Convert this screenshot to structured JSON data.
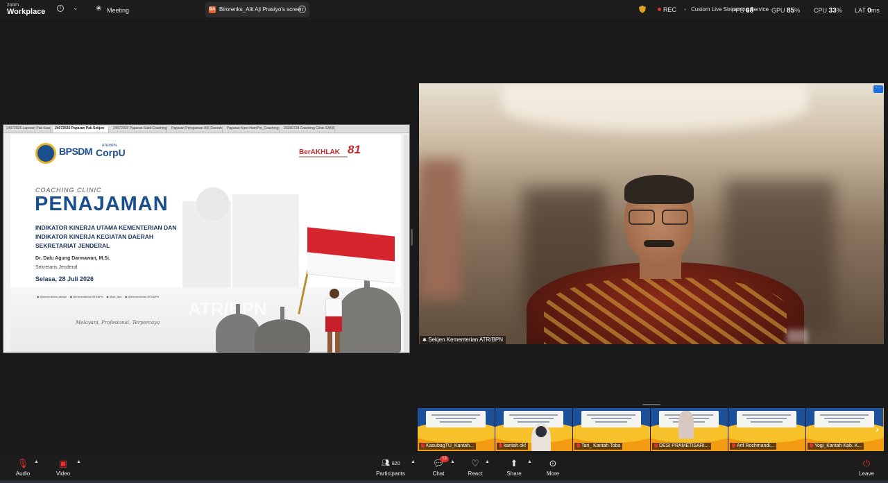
{
  "app": {
    "brand_small": "zoom",
    "brand_big": "Workplace"
  },
  "topbar": {
    "meeting_label": "Meeting",
    "share_tab_label": "Birorenks_Alit Aji Prastyo's screen",
    "share_tab_badge": "BA",
    "rec_label": "REC",
    "stream_label": "Custom Live Streaming Service",
    "stats": [
      {
        "label": "FPS",
        "value": "68"
      },
      {
        "label": "GPU",
        "value": "85",
        "unit": "%"
      },
      {
        "label": "CPU",
        "value": "33",
        "unit": "%"
      },
      {
        "label": "LAT",
        "value": "0",
        "unit": "ms"
      }
    ]
  },
  "shared_screen": {
    "tabs": [
      "24072026 Laporan Pak Kaur...",
      "24072026 Paparan Pak Sekjen",
      "24072026 Paparan Sakti Coaching C...",
      "Paparan Penajaman IKK Daerah - B...",
      "Paparan Karo HumPro_Coaching Clin...",
      "20260728 Coaching Clinic SAKIP Re..."
    ],
    "slide": {
      "logo_bpsdm": "BPSDM",
      "logo_corpu_top": "ATR/BPN",
      "logo_corpu": "CorpU",
      "logo_berakhlak": "BerAKHLAK",
      "logo_81": "81",
      "kicker": "COACHING CLINIC",
      "title": "PENAJAMAN",
      "subtitle_lines": [
        "INDIKATOR KINERJA UTAMA KEMENTERIAN DAN",
        "INDIKATOR KINERJA KEGIATAN DAERAH",
        "SEKRETARIAT JENDERAL"
      ],
      "presenter": "Dr. Dalu Agung Darmawan, M.Si.",
      "presenter_role": "Sekretaris Jenderal",
      "date": "Selasa, 28 Juli 2026",
      "socials": [
        "@kementerian.atrbpn",
        "@Kementerian ATRBPN",
        "@atr_bpn",
        "@Kementerian ATR/BPN"
      ],
      "tagline": "Melayani, Profesional, Terpercaya",
      "watermark": "ATR/BPN"
    }
  },
  "video": {
    "name": "Sekjen Kementerian ATR/BPN"
  },
  "thumbnails": [
    {
      "name": "KasubagTU_Kantah..."
    },
    {
      "name": "kantah okl"
    },
    {
      "name": "Tari_ Kantah Toba"
    },
    {
      "name": "DESI PRAMETISARI..."
    },
    {
      "name": "Arif Rochmandi..."
    },
    {
      "name": "Yogi_Kantah Kab. K..."
    }
  ],
  "bottombar": {
    "audio": "Audio",
    "video": "Video",
    "participants_count": "820",
    "participants": "Participants",
    "chat": "Chat",
    "chat_badge": "13",
    "react": "React",
    "share": "Share",
    "more": "More",
    "leave": "Leave"
  },
  "colors": {
    "accent": "#1f6fe0",
    "leave": "#e03131",
    "flag_red": "#d6262d",
    "title_blue": "#1b4e8c"
  }
}
